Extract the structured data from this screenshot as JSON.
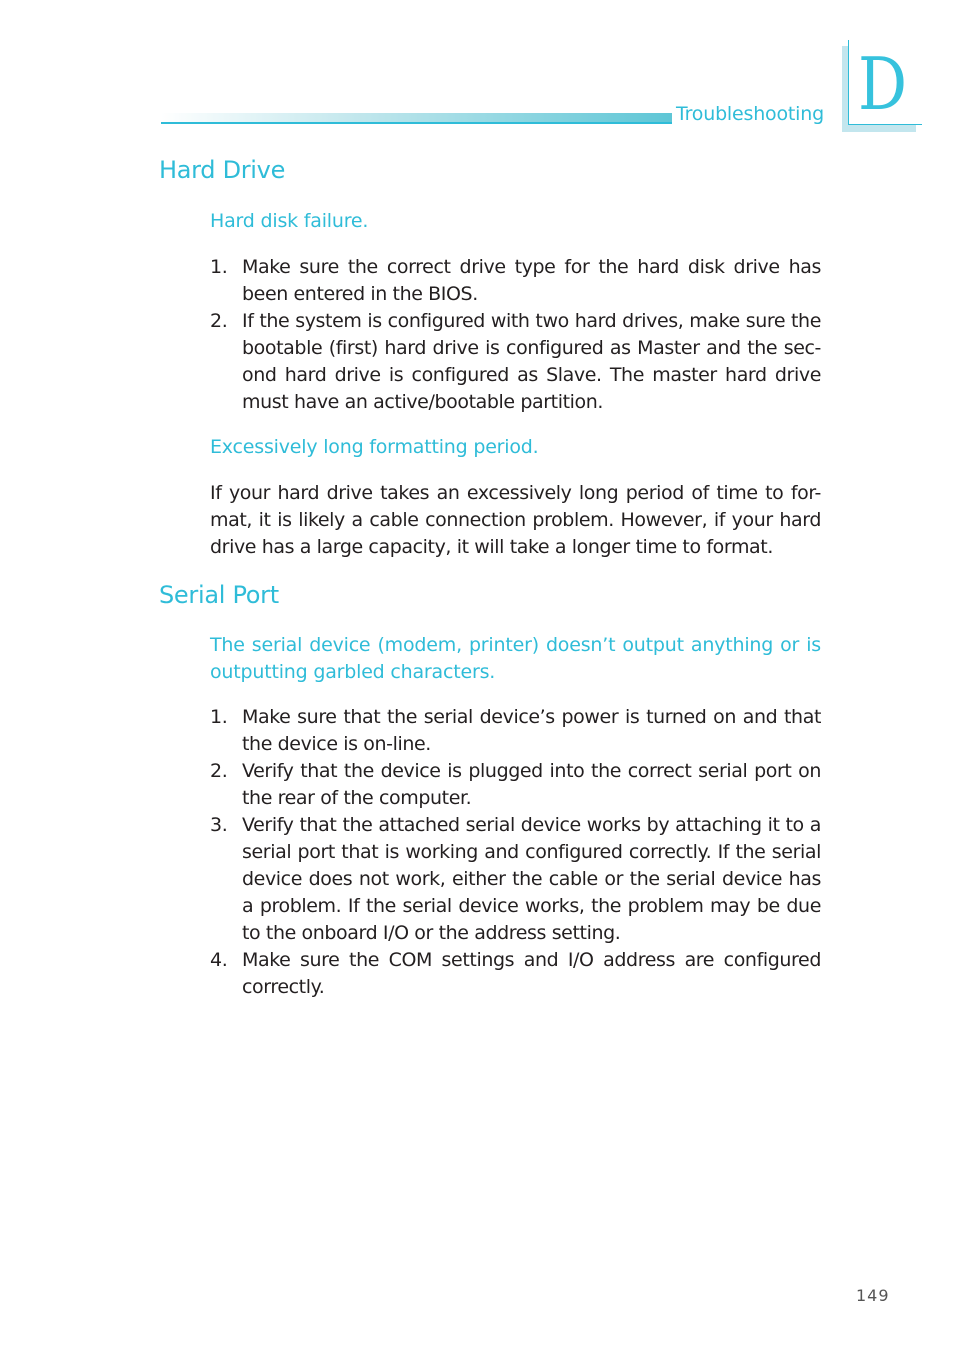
{
  "header": {
    "section_title": "Troubleshooting",
    "appendix_letter": "D",
    "accent_color": "#2fbcd8"
  },
  "sections": [
    {
      "title": "Hard Drive",
      "subsections": [
        {
          "heading": "Hard disk failure.",
          "items": [
            {
              "num": "1.",
              "text": "Make sure the correct drive type for the hard disk drive has been entered in the BIOS."
            },
            {
              "num": "2.",
              "text": "If the system is configured with two hard drives, make sure the bootable (first) hard drive is configured as Master and the sec-ond hard drive is configured as Slave. The master hard drive must have an active/bootable partition."
            }
          ]
        },
        {
          "heading": "Excessively long formatting period.",
          "paragraph": "If your hard drive takes an excessively long period of time to for-mat, it is likely a cable connection problem. However, if your hard drive has a large capacity, it will take a longer time to format."
        }
      ]
    },
    {
      "title": "Serial Port",
      "subsections": [
        {
          "heading": "The serial device (modem, printer) doesn’t output anything or is outputting garbled characters.",
          "items": [
            {
              "num": "1.",
              "text": "Make sure that the serial device’s power is turned on and that the device is on-line."
            },
            {
              "num": "2.",
              "text": "Verify that the device is plugged into the correct serial port on the rear of the computer."
            },
            {
              "num": "3.",
              "text": "Verify that the attached serial device works by attaching it to a serial port that is working and configured correctly. If the serial device does not work, either the cable or the serial device has a problem. If the serial device works, the problem may be due to the onboard I/O or the address setting."
            },
            {
              "num": "4.",
              "text": "Make sure the COM settings and I/O address are configured correctly."
            }
          ]
        }
      ]
    }
  ],
  "footer": {
    "page_number": "149"
  }
}
